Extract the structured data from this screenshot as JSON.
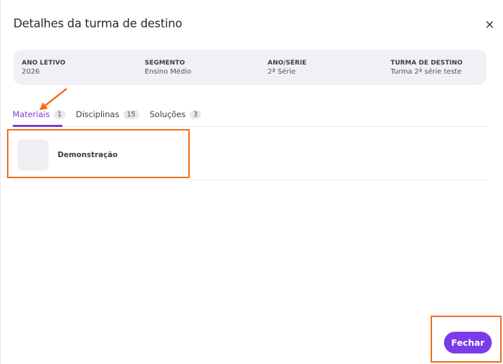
{
  "dialog": {
    "title": "Detalhes da turma de destino",
    "close_icon": "close-icon"
  },
  "info": {
    "columns": [
      {
        "label": "ANO LETIVO",
        "value": "2026"
      },
      {
        "label": "SEGMENTO",
        "value": "Ensino Médio"
      },
      {
        "label": "ANO/SÉRIE",
        "value": "2ª Série"
      },
      {
        "label": "TURMA DE DESTINO",
        "value": "Turma 2ª série teste"
      }
    ]
  },
  "tabs": [
    {
      "label": "Materiais",
      "count": "1",
      "active": true
    },
    {
      "label": "Disciplinas",
      "count": "15",
      "active": false
    },
    {
      "label": "Soluções",
      "count": "3",
      "active": false
    }
  ],
  "list": {
    "items": [
      {
        "title": "Demonstração"
      }
    ]
  },
  "footer": {
    "close_label": "Fechar"
  },
  "colors": {
    "accent": "#7a3ce8",
    "highlight": "#f46a12"
  }
}
